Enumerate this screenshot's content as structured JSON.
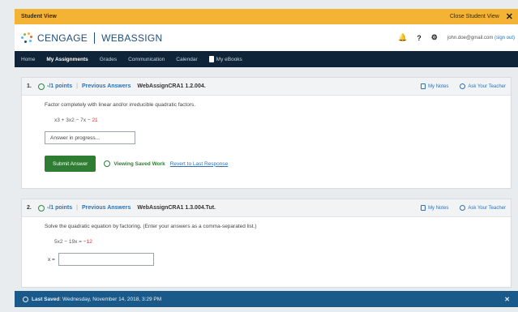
{
  "student_bar": {
    "label": "Student View",
    "close_label": "Close Student View",
    "close_x": "✕",
    "color": "#f5b335"
  },
  "header": {
    "brand_left": "CENGAGE",
    "brand_right": "WEBASSIGN",
    "icons": [
      "bell-icon",
      "help-icon",
      "gear-icon"
    ],
    "bell_glyph": "🔔",
    "help_glyph": "?",
    "gear_glyph": "⚙",
    "user_email": "john.doe@gmail.com",
    "signout": "(sign out)"
  },
  "nav": {
    "items": [
      "Home",
      "My Assignments",
      "Grades",
      "Communication",
      "Calendar"
    ],
    "active": "My Assignments",
    "ebooks": "My eBooks"
  },
  "questions": [
    {
      "number": "1.",
      "points": "-/1 points",
      "separator": "|",
      "prev": "Previous Answers",
      "ref": "WebAssignCRA1 1.2.004.",
      "notes": "My Notes",
      "ask": "Ask Your Teacher",
      "instruction": "Factor completely with linear and/or irreducible quadratic factors.",
      "expr_main": "x3 + 3x2 − 7x − ",
      "expr_red": "21",
      "answer_value": "Answer in progress...",
      "submit_label": "Submit Answer",
      "saved_label": "Viewing Saved Work",
      "revert_label": "Revert to Last Response"
    },
    {
      "number": "2.",
      "points": "-/1 points",
      "separator": "|",
      "prev": "Previous Answers",
      "ref": "WebAssignCRA1 1.3.004.Tut.",
      "notes": "My Notes",
      "ask": "Ask Your Teacher",
      "instruction": "Solve the quadratic equation by factoring. (Enter your answers as a comma-separated list.)",
      "expr_main": "5x2 − 19x = ",
      "expr_red": "−12",
      "x_label": "x ="
    }
  ],
  "save_bar": {
    "label": "Last Saved",
    "timestamp": ": Wednesday, November 14, 2018, 3:29 PM",
    "close": "✕"
  }
}
